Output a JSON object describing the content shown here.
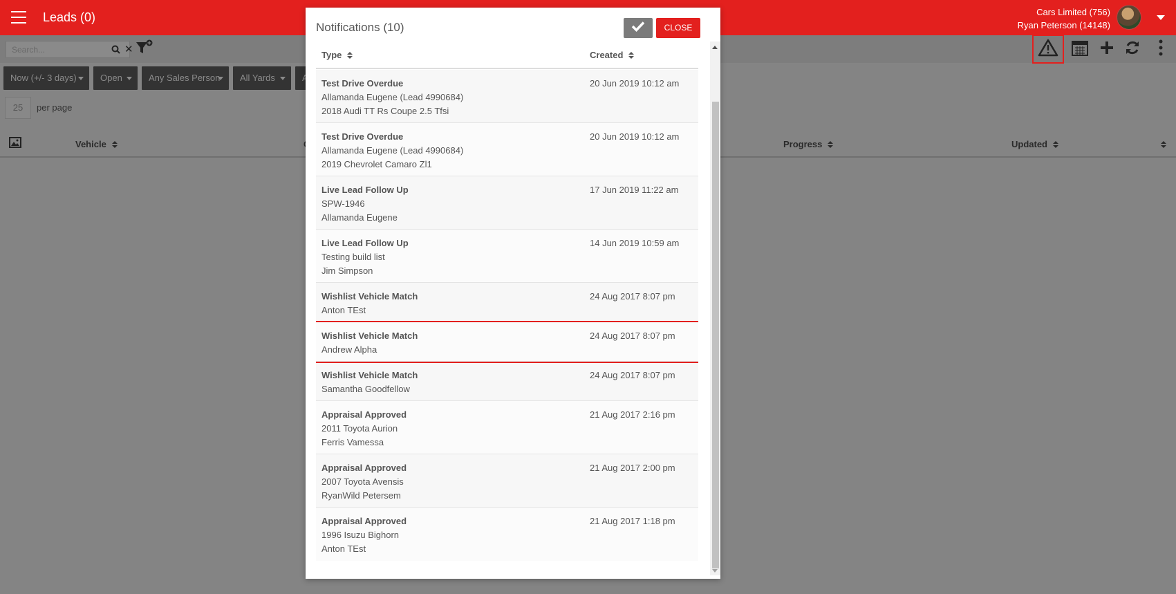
{
  "header": {
    "title": "Leads (0)",
    "account_company": "Cars Limited (756)",
    "account_user": "Ryan Peterson (14148)"
  },
  "toolbar": {
    "search_placeholder": "Search..."
  },
  "filters": [
    {
      "label": "Now (+/- 3 days)"
    },
    {
      "label": "Open"
    },
    {
      "label": "Any Sales Person"
    },
    {
      "label": "All Yards"
    },
    {
      "label": "A"
    }
  ],
  "pagination": {
    "per_page_value": "25",
    "per_page_label": "per page"
  },
  "leads_table": {
    "columns": [
      "Vehicle",
      "C",
      "Progress",
      "Updated"
    ]
  },
  "modal": {
    "title": "Notifications (10)",
    "close_label": "CLOSE",
    "columns": {
      "type": "Type",
      "created": "Created"
    },
    "rows": [
      {
        "type": "Test Drive Overdue",
        "line1": "Allamanda Eugene (Lead 4990684)",
        "line2": "2018 Audi TT Rs Coupe 2.5 Tfsi",
        "created": "20 Jun 2019 10:12 am"
      },
      {
        "type": "Test Drive Overdue",
        "line1": "Allamanda Eugene (Lead 4990684)",
        "line2": "2019 Chevrolet Camaro Zl1",
        "created": "20 Jun 2019 10:12 am"
      },
      {
        "type": "Live Lead Follow Up",
        "line1": "SPW-1946",
        "line2": "Allamanda Eugene",
        "created": "17 Jun 2019 11:22 am"
      },
      {
        "type": "Live Lead Follow Up",
        "line1": "Testing build list",
        "line2": "Jim Simpson",
        "created": "14 Jun 2019 10:59 am"
      },
      {
        "type": "Wishlist Vehicle Match",
        "line1": "Anton TEst",
        "line2": "",
        "created": "24 Aug 2017 8:07 pm"
      },
      {
        "type": "Wishlist Vehicle Match",
        "line1": "Andrew Alpha",
        "line2": "",
        "created": "24 Aug 2017 8:07 pm"
      },
      {
        "type": "Wishlist Vehicle Match",
        "line1": "Samantha Goodfellow",
        "line2": "",
        "created": "24 Aug 2017 8:07 pm"
      },
      {
        "type": "Appraisal Approved",
        "line1": "2011 Toyota Aurion",
        "line2": "Ferris Vamessa",
        "created": "21 Aug 2017 2:16 pm"
      },
      {
        "type": "Appraisal Approved",
        "line1": "2007 Toyota Avensis",
        "line2": "RyanWild Petersem",
        "created": "21 Aug 2017 2:00 pm"
      },
      {
        "type": "Appraisal Approved",
        "line1": "1996 Isuzu Bighorn",
        "line2": "Anton TEst",
        "created": "21 Aug 2017 1:18 pm"
      }
    ]
  },
  "colors": {
    "brand_red": "#e3201e",
    "overlay_gray": "#848484"
  }
}
